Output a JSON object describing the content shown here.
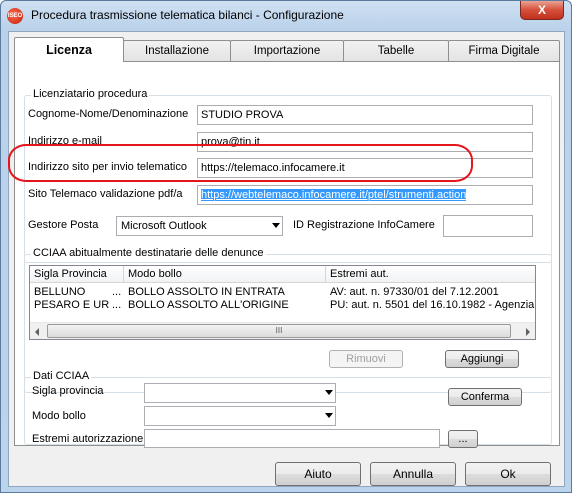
{
  "window": {
    "title": "Procedura trasmissione telematica bilanci - Configurazione",
    "icon_text": "ISEO",
    "close_symbol": "X"
  },
  "tabs": [
    "Licenza",
    "Installazione",
    "Importazione",
    "Tabelle",
    "Firma Digitale"
  ],
  "licenziatario": {
    "caption": "Licenziatario procedura",
    "cognome_label": "Cognome-Nome/Denominazione",
    "cognome_value": "STUDIO PROVA",
    "email_label": "Indirizzo e-mail",
    "email_value": "prova@tin.it",
    "sito_label": "Indirizzo sito per invio telematico",
    "sito_value": "https://telemaco.infocamere.it",
    "validazione_label": "Sito Telemaco validazione pdf/a",
    "validazione_value": "https://webtelemaco.infocamere.it/ptel/strumenti.action",
    "gestore_label": "Gestore Posta",
    "gestore_value": "Microsoft Outlook",
    "id_label": "ID Registrazione InfoCamere",
    "id_value": ""
  },
  "cciaa_list": {
    "caption": "CCIAA abitualmente destinatarie delle denunce",
    "columns": [
      "Sigla Provincia",
      "Modo bollo",
      "Estremi aut."
    ],
    "rows": [
      {
        "sigla": "BELLUNO",
        "dots": "...",
        "modo": "BOLLO ASSOLTO IN ENTRATA",
        "estremi": "AV: aut. n. 97330/01 del 7.12.2001"
      },
      {
        "sigla": "PESARO E URB...",
        "dots": "...",
        "modo": "BOLLO ASSOLTO ALL'ORIGINE",
        "estremi": "PU: aut. n. 5501 del 16.10.1982 - Agenzia"
      }
    ],
    "scroll_grip": "III",
    "rimuovi_label": "Rimuovi",
    "aggiungi_label": "Aggiungi"
  },
  "dati_cciaa": {
    "caption": "Dati CCIAA",
    "sigla_label": "Sigla provincia",
    "sigla_value": "",
    "modo_label": "Modo bollo",
    "modo_value": "",
    "estremi_label": "Estremi autorizzazione",
    "estremi_value": "",
    "conferma_label": "Conferma",
    "browse_label": "..."
  },
  "footer": {
    "aiuto_label": "Aiuto",
    "annulla_label": "Annulla",
    "ok_label": "Ok"
  },
  "colors": {
    "highlight_ring": "#e4151b",
    "selection": "#3399ff"
  }
}
